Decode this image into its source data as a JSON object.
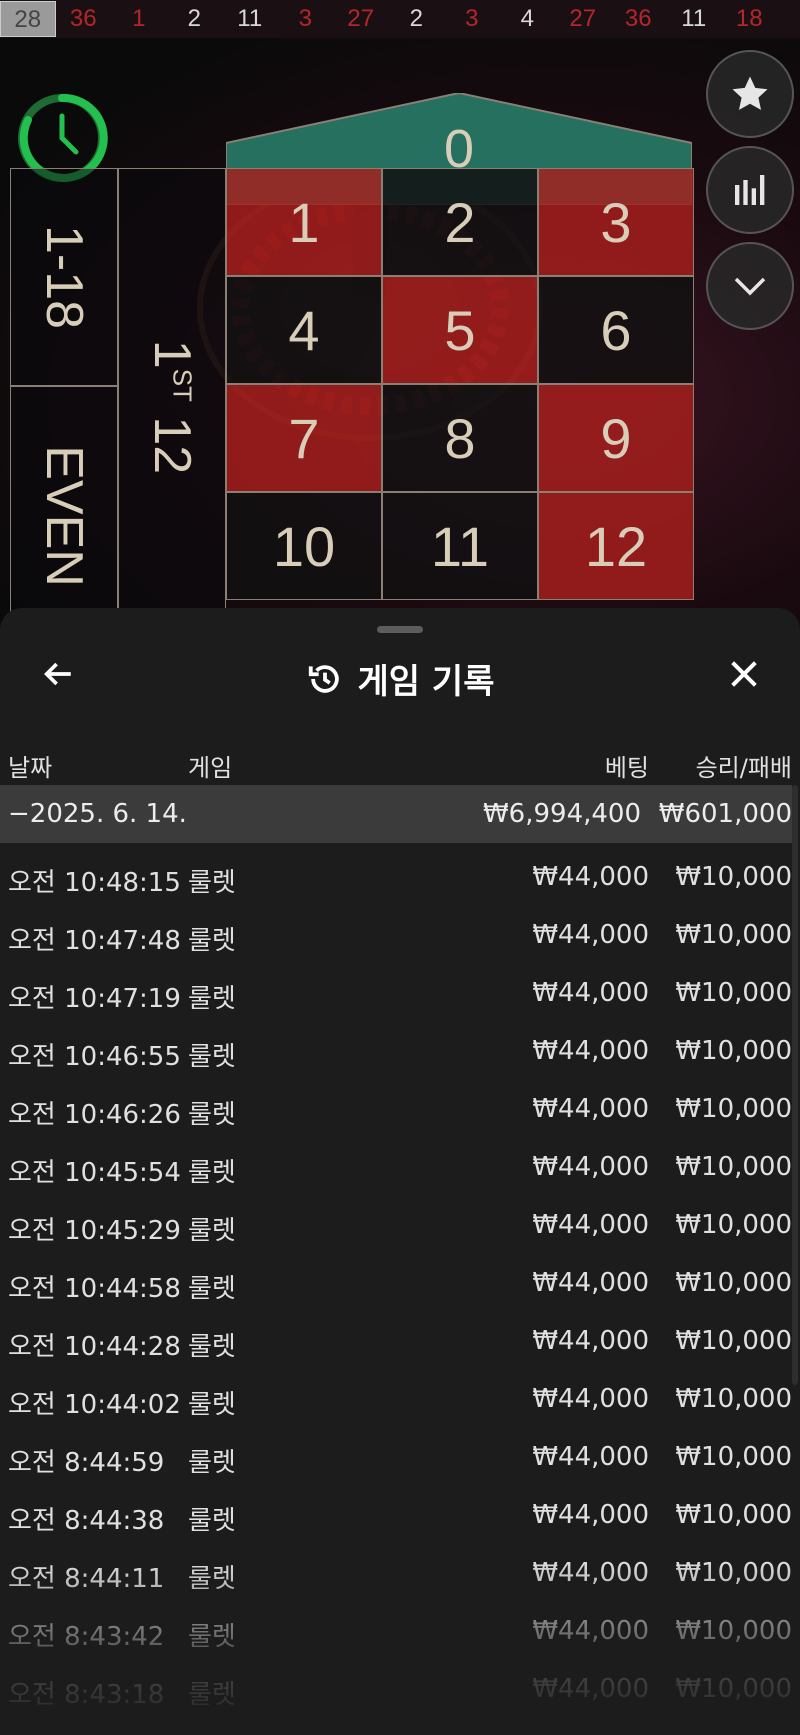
{
  "results_strip": [
    {
      "value": "28",
      "color": "current"
    },
    {
      "value": "36",
      "color": "red"
    },
    {
      "value": "1",
      "color": "red"
    },
    {
      "value": "2",
      "color": "black"
    },
    {
      "value": "11",
      "color": "black"
    },
    {
      "value": "3",
      "color": "red"
    },
    {
      "value": "27",
      "color": "red"
    },
    {
      "value": "2",
      "color": "black"
    },
    {
      "value": "3",
      "color": "red"
    },
    {
      "value": "4",
      "color": "black"
    },
    {
      "value": "27",
      "color": "red"
    },
    {
      "value": "36",
      "color": "red"
    },
    {
      "value": "11",
      "color": "black"
    },
    {
      "value": "18",
      "color": "red"
    }
  ],
  "table": {
    "zero": "0",
    "numbers": [
      {
        "n": "1",
        "c": "r"
      },
      {
        "n": "2",
        "c": "b"
      },
      {
        "n": "3",
        "c": "r"
      },
      {
        "n": "4",
        "c": "b"
      },
      {
        "n": "5",
        "c": "r"
      },
      {
        "n": "6",
        "c": "b"
      },
      {
        "n": "7",
        "c": "r"
      },
      {
        "n": "8",
        "c": "b"
      },
      {
        "n": "9",
        "c": "r"
      },
      {
        "n": "10",
        "c": "b"
      },
      {
        "n": "11",
        "c": "b"
      },
      {
        "n": "12",
        "c": "r"
      }
    ],
    "low_bet": "1-18",
    "even_bet": "EVEN",
    "dozen_num": "1",
    "dozen_suffix": "ST",
    "dozen_label": "12"
  },
  "side_buttons": {
    "favorites": "star-icon",
    "stats": "bar-chart-icon",
    "collapse": "chevron-down-icon"
  },
  "sheet": {
    "title": "게임 기록",
    "headers": {
      "date": "날짜",
      "game": "게임",
      "bet": "베팅",
      "winloss": "승리/패배"
    },
    "date_row": {
      "date": "−2025. 6. 14.",
      "bet": "₩6,994,400",
      "winloss": "₩601,000"
    },
    "rows": [
      {
        "time": "오전 10:48:15",
        "game": "룰렛",
        "bet": "₩44,000",
        "winloss": "₩10,000"
      },
      {
        "time": "오전 10:47:48",
        "game": "룰렛",
        "bet": "₩44,000",
        "winloss": "₩10,000"
      },
      {
        "time": "오전 10:47:19",
        "game": "룰렛",
        "bet": "₩44,000",
        "winloss": "₩10,000"
      },
      {
        "time": "오전 10:46:55",
        "game": "룰렛",
        "bet": "₩44,000",
        "winloss": "₩10,000"
      },
      {
        "time": "오전 10:46:26",
        "game": "룰렛",
        "bet": "₩44,000",
        "winloss": "₩10,000"
      },
      {
        "time": "오전 10:45:54",
        "game": "룰렛",
        "bet": "₩44,000",
        "winloss": "₩10,000"
      },
      {
        "time": "오전 10:45:29",
        "game": "룰렛",
        "bet": "₩44,000",
        "winloss": "₩10,000"
      },
      {
        "time": "오전 10:44:58",
        "game": "룰렛",
        "bet": "₩44,000",
        "winloss": "₩10,000"
      },
      {
        "time": "오전 10:44:28",
        "game": "룰렛",
        "bet": "₩44,000",
        "winloss": "₩10,000"
      },
      {
        "time": "오전 10:44:02",
        "game": "룰렛",
        "bet": "₩44,000",
        "winloss": "₩10,000"
      },
      {
        "time": "오전 8:44:59",
        "game": "룰렛",
        "bet": "₩44,000",
        "winloss": "₩10,000"
      },
      {
        "time": "오전 8:44:38",
        "game": "룰렛",
        "bet": "₩44,000",
        "winloss": "₩10,000"
      },
      {
        "time": "오전 8:44:11",
        "game": "룰렛",
        "bet": "₩44,000",
        "winloss": "₩10,000"
      },
      {
        "time": "오전 8:43:42",
        "game": "룰렛",
        "bet": "₩44,000",
        "winloss": "₩10,000"
      },
      {
        "time": "오전 8:43:18",
        "game": "룰렛",
        "bet": "₩44,000",
        "winloss": "₩10,000"
      }
    ]
  }
}
